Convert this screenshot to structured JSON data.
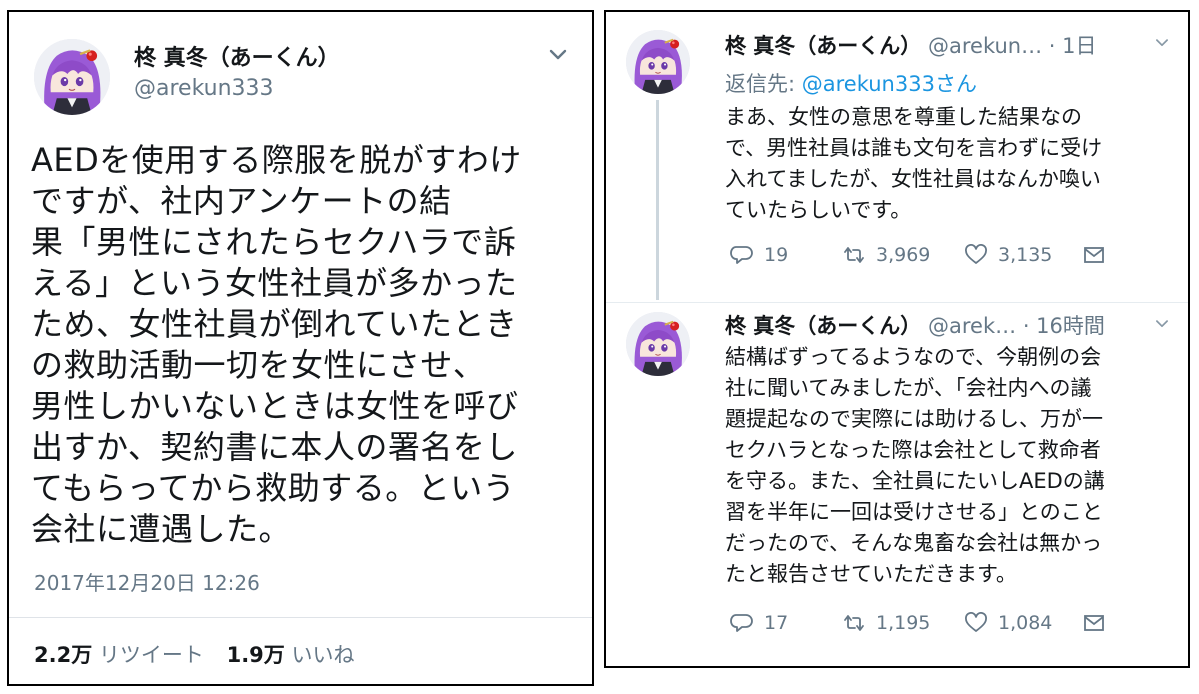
{
  "left_tweet": {
    "name": "柊 真冬（あーくん）",
    "handle": "@arekun333",
    "body_lines": [
      "AEDを使用する際服を脱がすわけ",
      "ですが、社内アンケートの結",
      "果「男性にされたらセクハラで訴",
      "える」という女性社員が多かった",
      "ため、女性社員が倒れていたとき",
      "の救助活動一切を女性にさせ、",
      "男性しかいないときは女性を呼び",
      "出すか、契約書に本人の署名をし",
      "てもらってから救助する。という",
      "会社に遭遇した。"
    ],
    "date": "2017年12月20日 12:26",
    "retweets": {
      "count": "2.2万",
      "label": "リツイート"
    },
    "likes": {
      "count": "1.9万",
      "label": "いいね"
    },
    "icons": {
      "menu": "chevron-down-icon",
      "avatar": "avatar"
    }
  },
  "reply1": {
    "name": "柊 真冬（あーくん）",
    "handle": "@arekun…",
    "time": "· 1日",
    "reply_prefix": "返信先: ",
    "reply_to": "@arekun333さん",
    "text_lines": [
      "まあ、女性の意思を尊重した結果なの",
      "で、男性社員は誰も文句を言わずに受け",
      "入れてましたが、女性社員はなんか喚い",
      "ていたらしいです。"
    ],
    "replies": "19",
    "retweets": "3,969",
    "likes": "3,135"
  },
  "reply2": {
    "name": "柊 真冬（あーくん）",
    "handle": "@arek…",
    "time": "· 16時間",
    "text_lines": [
      "結構ばずってるようなので、今朝例の会",
      "社に聞いてみましたが、「会社内への議",
      "題提起なので実際には助けるし、万が一",
      "セクハラとなった際は会社として救命者",
      "を守る。また、全社員にたいしAEDの講",
      "習を半年に一回は受けさせる」とのこと",
      "だったので、そんな鬼畜な会社は無かっ",
      "たと報告させていただきます。"
    ],
    "replies": "17",
    "retweets": "1,195",
    "likes": "1,084"
  },
  "colors": {
    "text": "#14171a",
    "secondary": "#657786",
    "link": "#1b95e0",
    "thread_line": "#ccd6dd",
    "hair": "#8e4bc8"
  },
  "action_icons": [
    "reply-icon",
    "retweet-icon",
    "like-icon",
    "dm-icon"
  ]
}
